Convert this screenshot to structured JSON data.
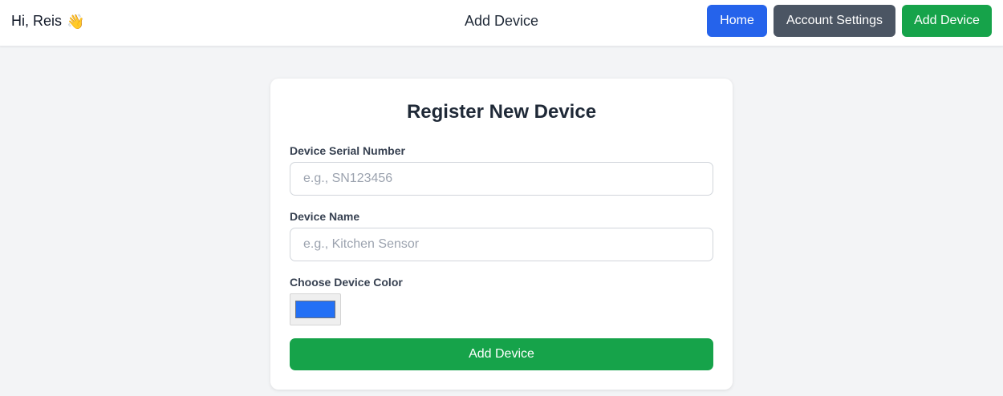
{
  "header": {
    "greeting": "Hi, Reis",
    "greeting_icon": "👋",
    "title": "Add Device",
    "nav": {
      "home_label": "Home",
      "account_label": "Account Settings",
      "add_label": "Add Device"
    }
  },
  "form": {
    "title": "Register New Device",
    "serial": {
      "label": "Device Serial Number",
      "placeholder": "e.g., SN123456",
      "value": ""
    },
    "name": {
      "label": "Device Name",
      "placeholder": "e.g., Kitchen Sensor",
      "value": ""
    },
    "color": {
      "label": "Choose Device Color",
      "value": "#2370f5"
    },
    "submit_label": "Add Device"
  },
  "colors": {
    "home_button": "#2563eb",
    "account_button": "#4b5563",
    "add_button": "#16a34a",
    "page_background": "#f3f4f6"
  }
}
